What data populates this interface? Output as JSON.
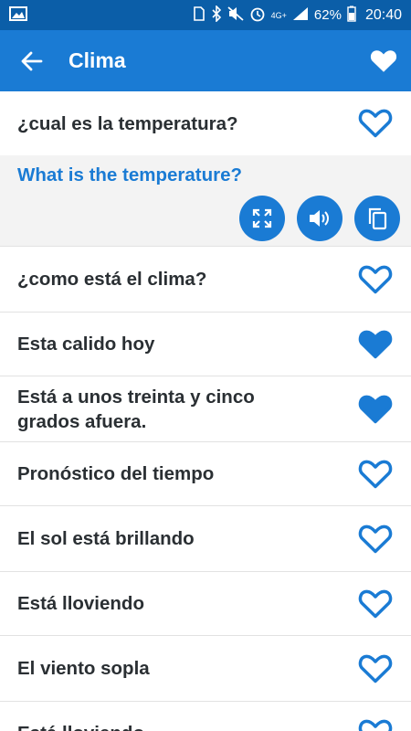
{
  "status_bar": {
    "battery": "62%",
    "time": "20:40",
    "network": "4G+"
  },
  "app_bar": {
    "title": "Clima"
  },
  "expanded": {
    "phrase": "¿cual es la temperatura?",
    "translation": "What is the temperature?",
    "favorite": false
  },
  "phrases": [
    {
      "text": "¿como está el clima?",
      "favorite": false
    },
    {
      "text": "Esta calido hoy",
      "favorite": true
    },
    {
      "text": "Está a unos treinta y cinco grados afuera.",
      "favorite": true
    },
    {
      "text": "Pronóstico del tiempo",
      "favorite": false
    },
    {
      "text": "El sol está brillando",
      "favorite": false
    },
    {
      "text": "Está lloviendo",
      "favorite": false
    },
    {
      "text": "El viento sopla",
      "favorite": false
    },
    {
      "text": "Está lloviendo",
      "favorite": false
    }
  ],
  "colors": {
    "primary": "#1a7bd4",
    "status_bar": "#0b5ea8",
    "text": "#2a2f33"
  },
  "icons": {
    "back": "arrow-left-icon",
    "favorite_header": "heart-filled-icon",
    "fullscreen": "fullscreen-icon",
    "speaker": "speaker-icon",
    "copy": "copy-icon"
  }
}
